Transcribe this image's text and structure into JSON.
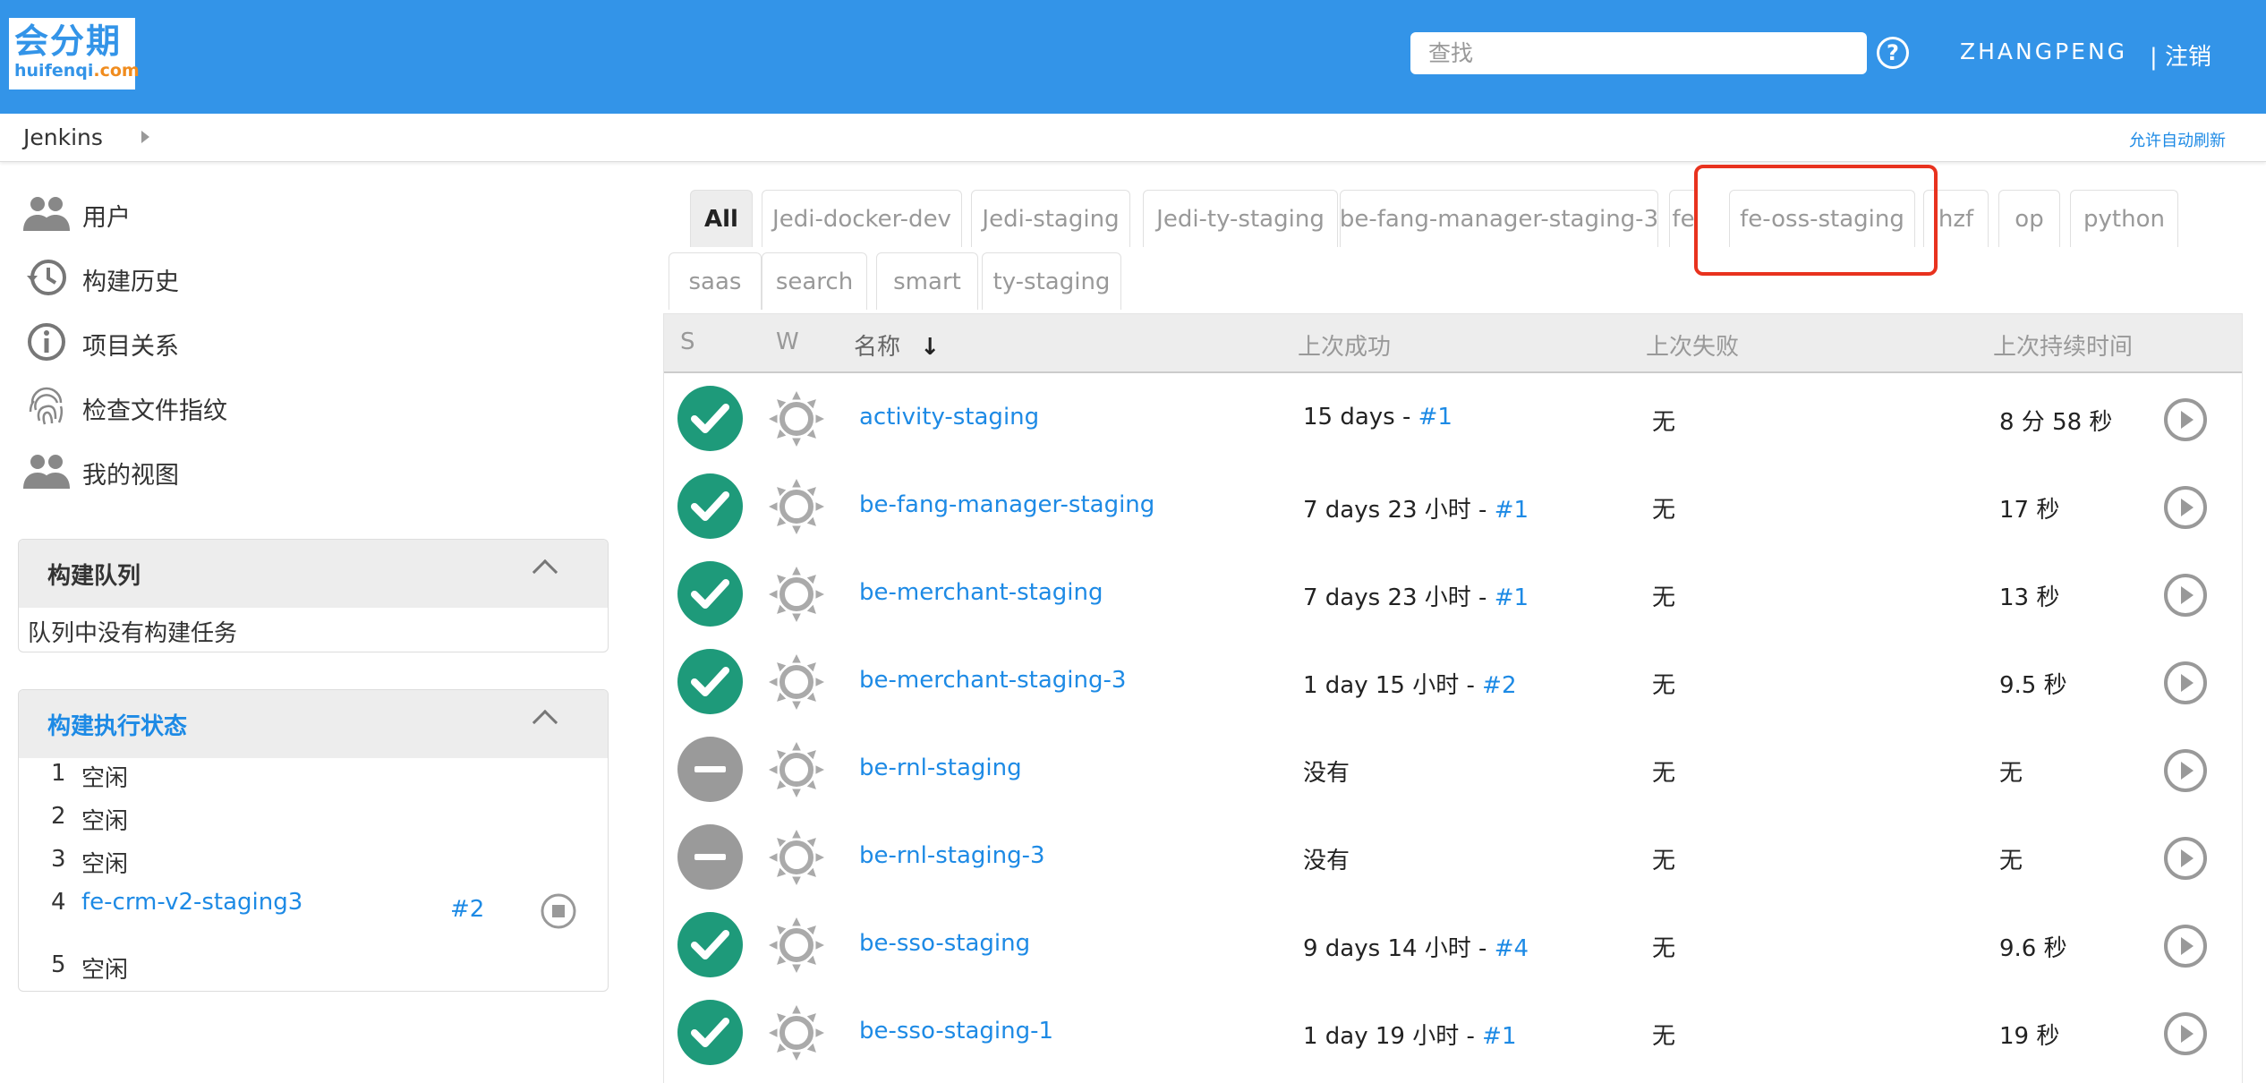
{
  "header": {
    "logo_main": "会分期",
    "logo_sub_a": "huifenqi",
    "logo_sub_b": ".com",
    "search_placeholder": "查找",
    "help": "?",
    "user": "ZHANGPENG",
    "logout": "| 注销"
  },
  "breadcrumb": {
    "root": "Jenkins",
    "auto_refresh": "允许自动刷新"
  },
  "sidebar": [
    {
      "label": "用户",
      "icon": "people-icon"
    },
    {
      "label": "构建历史",
      "icon": "history-icon"
    },
    {
      "label": "项目关系",
      "icon": "info-icon"
    },
    {
      "label": "检查文件指纹",
      "icon": "fingerprint-icon"
    },
    {
      "label": "我的视图",
      "icon": "people-icon"
    }
  ],
  "queue": {
    "title": "构建队列",
    "empty": "队列中没有构建任务"
  },
  "executors": {
    "title": "构建执行状态",
    "rows": [
      {
        "num": "1",
        "label": "空闲"
      },
      {
        "num": "2",
        "label": "空闲"
      },
      {
        "num": "3",
        "label": "空闲"
      },
      {
        "num": "4",
        "label": "fe-crm-v2-staging3",
        "build": "#2"
      },
      {
        "num": "5",
        "label": "空闲"
      }
    ]
  },
  "tabs": [
    "All",
    "Jedi-docker-dev",
    "Jedi-staging",
    "Jedi-ty-staging",
    "be-fang-manager-staging-3",
    "fe",
    "fe-oss-staging",
    "hzf",
    "op",
    "python",
    "saas",
    "search",
    "smart",
    "ty-staging"
  ],
  "table": {
    "headers": {
      "s": "S",
      "w": "W",
      "name": "名称",
      "sort": "↓",
      "last_success": "上次成功",
      "last_failure": "上次失败",
      "last_duration": "上次持续时间"
    },
    "rows": [
      {
        "status": "success",
        "name": "activity-staging",
        "ls_text": "15 days - ",
        "ls_build": "#1",
        "lf": "无",
        "ld": "8 分 58 秒"
      },
      {
        "status": "success",
        "name": "be-fang-manager-staging",
        "ls_text": "7 days 23 小时 - ",
        "ls_build": "#1",
        "lf": "无",
        "ld": "17 秒"
      },
      {
        "status": "success",
        "name": "be-merchant-staging",
        "ls_text": "7 days 23 小时 - ",
        "ls_build": "#1",
        "lf": "无",
        "ld": "13 秒"
      },
      {
        "status": "success",
        "name": "be-merchant-staging-3",
        "ls_text": "1 day 15 小时 - ",
        "ls_build": "#2",
        "lf": "无",
        "ld": "9.5 秒"
      },
      {
        "status": "notbuilt",
        "name": "be-rnl-staging",
        "ls_text": "没有",
        "ls_build": "",
        "lf": "无",
        "ld": "无"
      },
      {
        "status": "notbuilt",
        "name": "be-rnl-staging-3",
        "ls_text": "没有",
        "ls_build": "",
        "lf": "无",
        "ld": "无"
      },
      {
        "status": "success",
        "name": "be-sso-staging",
        "ls_text": "9 days 14 小时 - ",
        "ls_build": "#4",
        "lf": "无",
        "ld": "9.6 秒"
      },
      {
        "status": "success",
        "name": "be-sso-staging-1",
        "ls_text": "1 day 19 小时 - ",
        "ls_build": "#1",
        "lf": "无",
        "ld": "19 秒"
      }
    ]
  },
  "colors": {
    "header": "#3394e8",
    "link": "#1d8ae5",
    "success": "#1e9a7a",
    "notbuilt": "#9a9a9a",
    "highlight": "#e8321e"
  }
}
